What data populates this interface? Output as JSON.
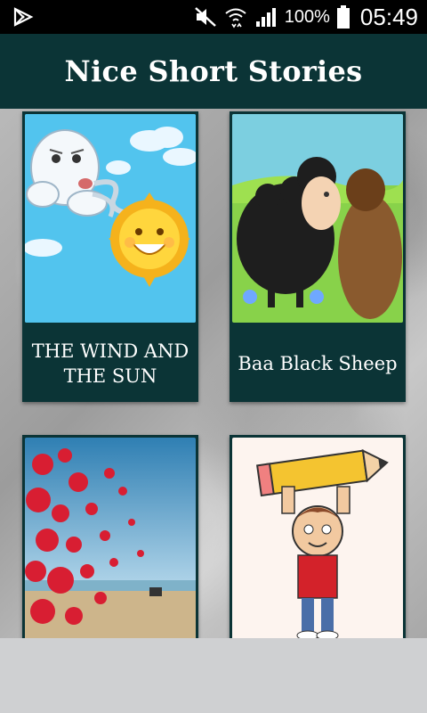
{
  "status_bar": {
    "battery_text": "100%",
    "time": "05:49"
  },
  "app_bar": {
    "title": "Nice Short Stories"
  },
  "stories": [
    {
      "title": "THE WIND AND THE SUN",
      "image": "wind-and-sun-illustration"
    },
    {
      "title": "Baa Black Sheep",
      "image": "black-sheep-illustration"
    },
    {
      "title": "",
      "image": "red-balloons-beach-photo"
    },
    {
      "title": "",
      "image": "boy-with-pencil-illustration"
    }
  ],
  "colors": {
    "app_bar": "#0b3436",
    "card": "#0b3436",
    "status_bar": "#000000",
    "bottom_panel": "#cfd0d2"
  }
}
